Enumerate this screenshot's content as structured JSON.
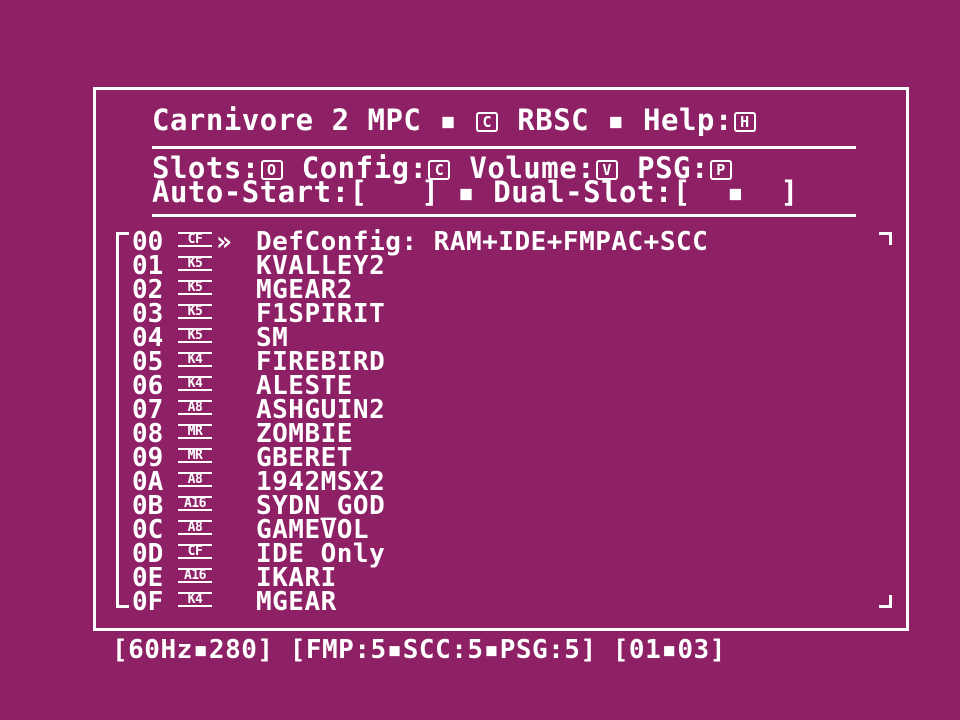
{
  "header": {
    "title": "Carnivore 2 MPC",
    "sep": "▪",
    "copyright_key": "C",
    "author": "RBSC",
    "help_label": "Help:",
    "help_key": "H"
  },
  "options": {
    "slots_label": "Slots:",
    "slots_key": "O",
    "config_label": "Config:",
    "config_key": "C",
    "volume_label": "Volume:",
    "volume_key": "V",
    "psg_label": "PSG:",
    "psg_key": "P",
    "autostart_label": "Auto-Start:",
    "autostart_value": "[   ]",
    "dualslot_label": "Dual-Slot:",
    "dualslot_value": "[  ▪  ]"
  },
  "entries": [
    {
      "index": "00",
      "type": "CF",
      "name": "DefConfig: RAM+IDE+FMPAC+SCC",
      "selected": true
    },
    {
      "index": "01",
      "type": "K5",
      "name": "KVALLEY2"
    },
    {
      "index": "02",
      "type": "K5",
      "name": "MGEAR2"
    },
    {
      "index": "03",
      "type": "K5",
      "name": "F1SPIRIT"
    },
    {
      "index": "04",
      "type": "K5",
      "name": "SM"
    },
    {
      "index": "05",
      "type": "K4",
      "name": "FIREBIRD"
    },
    {
      "index": "06",
      "type": "K4",
      "name": "ALESTE"
    },
    {
      "index": "07",
      "type": "A8",
      "name": "ASHGUIN2"
    },
    {
      "index": "08",
      "type": "MR",
      "name": "ZOMBIE"
    },
    {
      "index": "09",
      "type": "MR",
      "name": "GBERET"
    },
    {
      "index": "0A",
      "type": "A8",
      "name": "1942MSX2"
    },
    {
      "index": "0B",
      "type": "A16",
      "name": "SYDN_GOD"
    },
    {
      "index": "0C",
      "type": "A8",
      "name": "GAMEVOL"
    },
    {
      "index": "0D",
      "type": "CF",
      "name": "IDE Only"
    },
    {
      "index": "0E",
      "type": "A16",
      "name": "IKARI"
    },
    {
      "index": "0F",
      "type": "K4",
      "name": "MGEAR"
    }
  ],
  "selection_arrow": "»",
  "status": {
    "video": "[60Hz▪280]",
    "volumes": "[FMP:5▪SCC:5▪PSG:5]",
    "page": "[01▪03]"
  },
  "colors": {
    "background": "#8e2065",
    "foreground": "#ffffff"
  }
}
